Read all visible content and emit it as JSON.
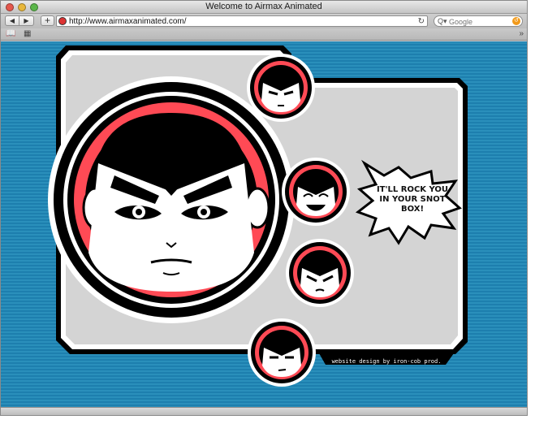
{
  "window": {
    "title": "Welcome to Airmax Animated"
  },
  "toolbar": {
    "back_label": "◀",
    "forward_label": "▶",
    "add_label": "+",
    "url": "http://www.airmaxanimated.com/",
    "reload_glyph": "↻",
    "search_placeholder": "Google",
    "search_glyph": "Q▾"
  },
  "page": {
    "speech_bubble": "IT'LL ROCK YOU IN YOUR SNOT BOX!",
    "credit": "website design by iron-cob prod."
  },
  "colors": {
    "background_blue": "#2a8fbb",
    "panel_gray": "#d4d4d4",
    "ring_red": "#ff4a55",
    "outline_black": "#000000"
  }
}
